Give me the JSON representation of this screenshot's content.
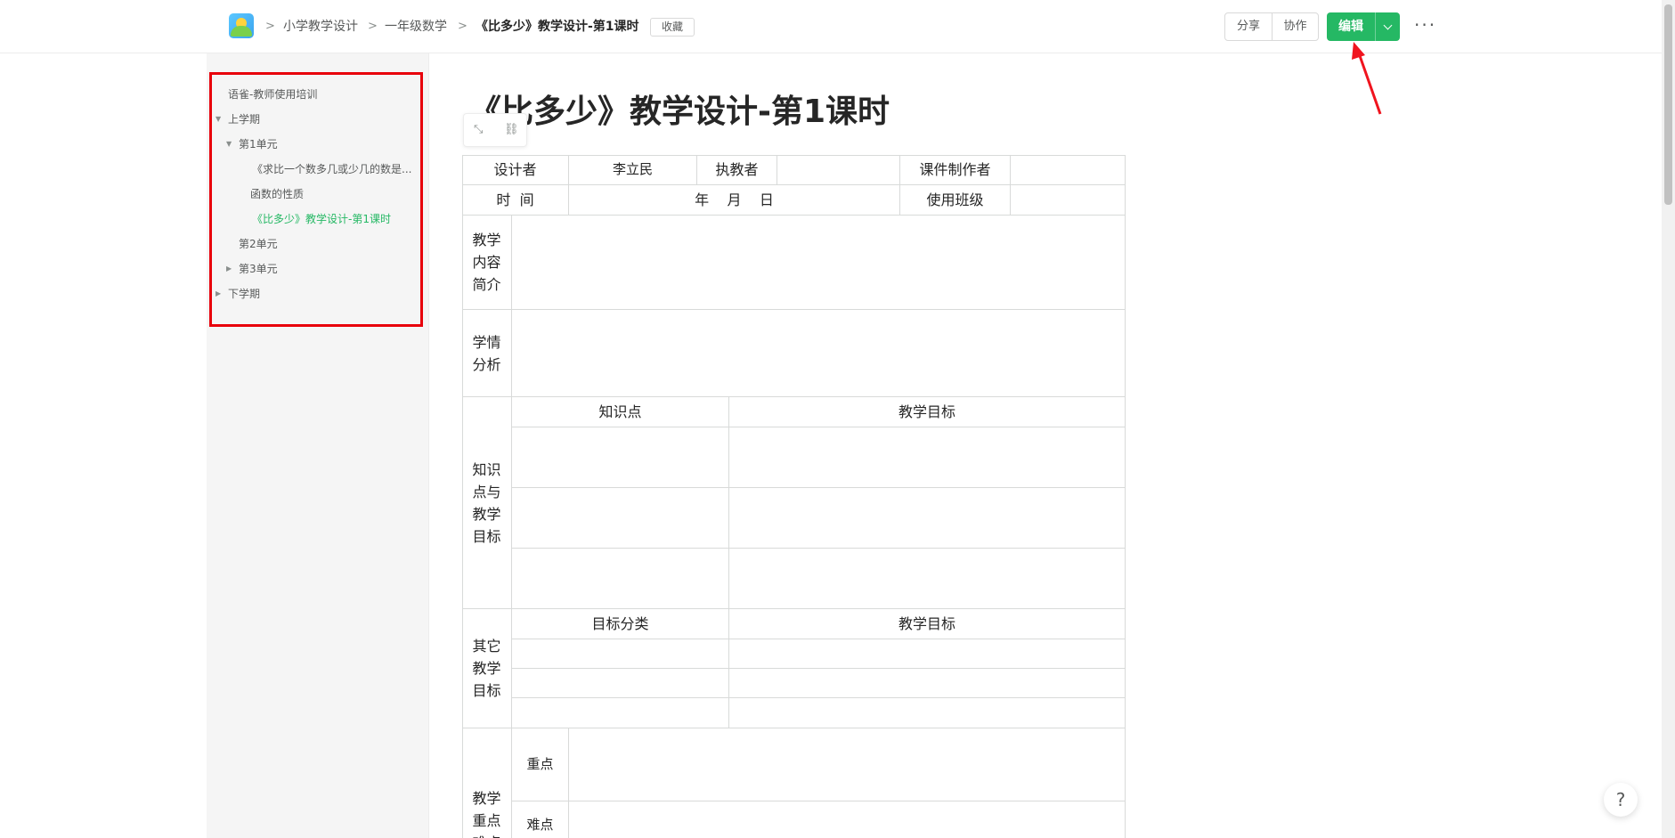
{
  "header": {
    "breadcrumbs": [
      "小学教学设计",
      "一年级数学",
      "《比多少》教学设计-第1课时"
    ],
    "favorite_label": "收藏",
    "share_label": "分享",
    "collab_label": "协作",
    "edit_label": "编辑",
    "more_label": "···",
    "accent": "#25b864"
  },
  "sidebar": {
    "items": [
      {
        "label": "语雀-教师使用培训"
      },
      {
        "label": "上学期"
      },
      {
        "label": "第1单元"
      },
      {
        "label": "《求比一个数多几或少几的数是..."
      },
      {
        "label": "函数的性质"
      },
      {
        "label": "《比多少》教学设计-第1课时"
      },
      {
        "label": "第2单元"
      },
      {
        "label": "第3单元"
      },
      {
        "label": "下学期"
      }
    ],
    "highlight_color": "#e8000b"
  },
  "doc": {
    "title": "《比多少》教学设计-第1课时",
    "table": {
      "designer_label": "设计者",
      "designer_value": "李立民",
      "teacher_label": "执教者",
      "courseware_label": "课件制作者",
      "time_label": "时  间",
      "date_value": "年    月    日",
      "class_label": "使用班级",
      "intro_label": "教学内容简介",
      "analysis_label": "学情分析",
      "knowledge_section_label": "知识点与教学目标",
      "knowledge_col": "知识点",
      "goal_col": "教学目标",
      "other_section_label": "其它教学目标",
      "goal_type_col": "目标分类",
      "other_goal_col": "教学目标",
      "focus_section_label": "教学重点难点",
      "key_point_label": "重点",
      "difficulty_label": "难点"
    }
  },
  "help_label": "?"
}
